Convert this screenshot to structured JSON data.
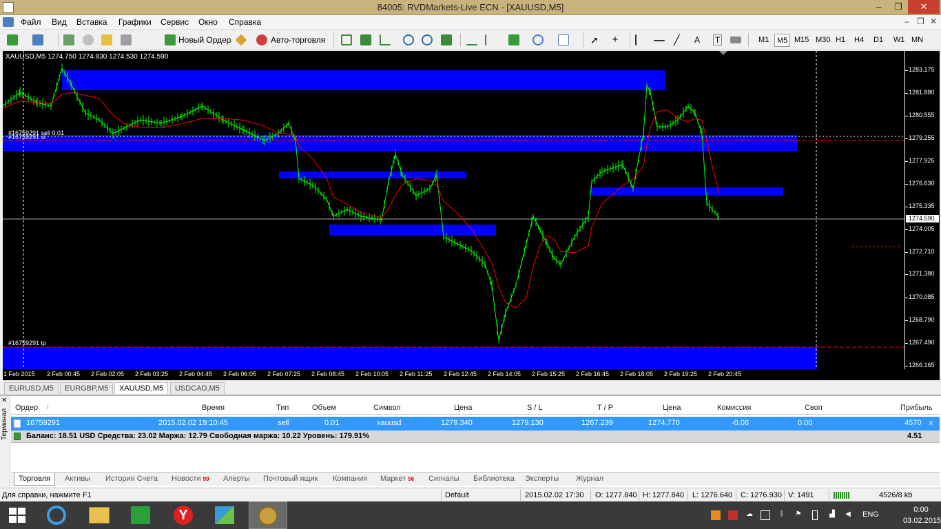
{
  "window": {
    "title": "84005: RVDMarkets-Live ECN - [XAUUSD,M5]",
    "min": "–",
    "restore": "❐",
    "close": "✕"
  },
  "menu": {
    "items": [
      "Файл",
      "Вид",
      "Вставка",
      "Графики",
      "Сервис",
      "Окно",
      "Справка"
    ],
    "mdi": [
      "–",
      "❐",
      "✕"
    ]
  },
  "toolbar": {
    "new_order": "Новый Ордер",
    "autotrade": "Авто-торговля",
    "text_tool": "A",
    "text_tool2": "T",
    "timeframes": [
      "M1",
      "M5",
      "M15",
      "M30",
      "H1",
      "H4",
      "D1",
      "W1",
      "MN"
    ],
    "active_timeframe": "M5"
  },
  "chart": {
    "header": "XAUUSD,M5  1274.750 1274.830 1274.530 1274.590",
    "sl_label": "#16759291 sl",
    "sell_label": "#16759291 sell 0.01",
    "tp_label": "#16759291 tp",
    "current_price": "1274.590",
    "price_labels": [
      "1283.175",
      "1281.880",
      "1280.555",
      "1279.255",
      "1277.925",
      "1276.630",
      "1275.335",
      "1274.005",
      "1272.710",
      "1271.380",
      "1270.085",
      "1268.790",
      "1267.490",
      "1266.165"
    ],
    "time_labels": [
      "1 Feb 2015",
      "2 Feb 00:45",
      "2 Feb 02:05",
      "2 Feb 03:25",
      "2 Feb 04:45",
      "2 Feb 06:05",
      "2 Feb 07:25",
      "2 Feb 08:45",
      "2 Feb 10:05",
      "2 Feb 11:25",
      "2 Feb 12:45",
      "2 Feb 14:05",
      "2 Feb 15:25",
      "2 Feb 16:45",
      "2 Feb 18:05",
      "2 Feb 19:25",
      "2 Feb 20:45"
    ]
  },
  "chart_tabs": [
    {
      "label": "EURUSD,M5",
      "active": false
    },
    {
      "label": "EURGBP,M5",
      "active": false
    },
    {
      "label": "XAUUSD,M5",
      "active": true
    },
    {
      "label": "USDCAD,M5",
      "active": false
    }
  ],
  "terminal": {
    "side_label": "Терминал",
    "columns": {
      "order": "Ордер",
      "sort_mark": "/",
      "time": "Время",
      "type": "Тип",
      "volume": "Объем",
      "symbol": "Символ",
      "price": "Цена",
      "sl": "S / L",
      "tp": "T / P",
      "price2": "Цена",
      "commission": "Комиссия",
      "swap": "Своп",
      "profit": "Прибыль"
    },
    "row": {
      "order": "16759291",
      "time": "2015.02.02 19:10:45",
      "type": "sell",
      "volume": "0.01",
      "symbol": "xauusd",
      "price": "1279.340",
      "sl": "1279.130",
      "tp": "1267.239",
      "price2": "1274.770",
      "commission": "-0.06",
      "swap": "0.00",
      "profit": "4570",
      "close": "✕"
    },
    "balance": {
      "text": "Баланс: 18.51 USD  Средства: 23.02  Маржа: 12.79  Свободная маржа: 10.22  Уровень: 179.91%",
      "total": "4.51"
    },
    "tabs": [
      {
        "label": "Торговля",
        "count": "",
        "active": true
      },
      {
        "label": "Активы",
        "count": ""
      },
      {
        "label": "История Счета",
        "count": ""
      },
      {
        "label": "Новости",
        "count": "99"
      },
      {
        "label": "Алерты",
        "count": ""
      },
      {
        "label": "Почтовый ящик",
        "count": ""
      },
      {
        "label": "Компания",
        "count": ""
      },
      {
        "label": "Маркет",
        "count": "56"
      },
      {
        "label": "Сигналы",
        "count": ""
      },
      {
        "label": "Библиотека",
        "count": ""
      },
      {
        "label": "Эксперты",
        "count": ""
      },
      {
        "label": "Журнал",
        "count": ""
      }
    ]
  },
  "status": {
    "help": "Для справки, нажмите F1",
    "profile": "Default",
    "datetime": "2015.02.02 17:30",
    "open": "O: 1277.840",
    "high": "H: 1277.840",
    "low": "L: 1276.640",
    "close": "C: 1276.930",
    "volume": "V: 1491",
    "traffic": "4526/8 kb"
  },
  "taskbar": {
    "time": "0:00",
    "date": "03.02.2015",
    "lang": "ENG"
  },
  "colors": {
    "zone": "#0000ff",
    "candle": "#00ff00",
    "ma": "#ff0000",
    "sl_line": "#ff0000"
  }
}
